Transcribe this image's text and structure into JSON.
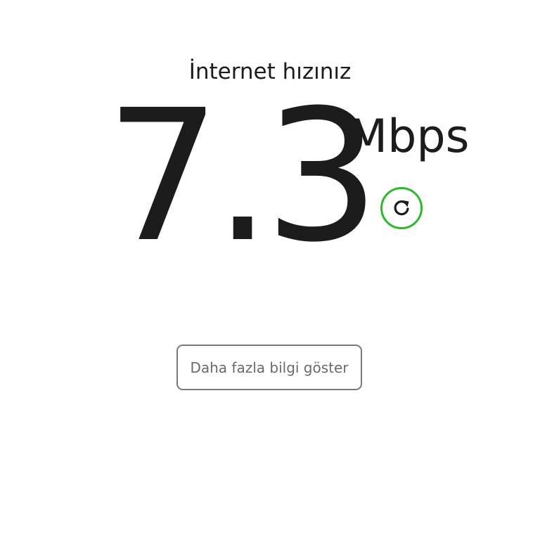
{
  "speedtest": {
    "title": "İnternet hızınız",
    "speed_value": "7.3",
    "speed_unit": "Mbps",
    "refresh_icon": "refresh-icon",
    "more_info_label": "Daha fazla bilgi göster"
  },
  "colors": {
    "accent": "#2eb82e",
    "text": "#1c1c1c",
    "button_border": "#7a7a7a",
    "button_text": "#6a6a6a",
    "background": "#ffffff"
  }
}
